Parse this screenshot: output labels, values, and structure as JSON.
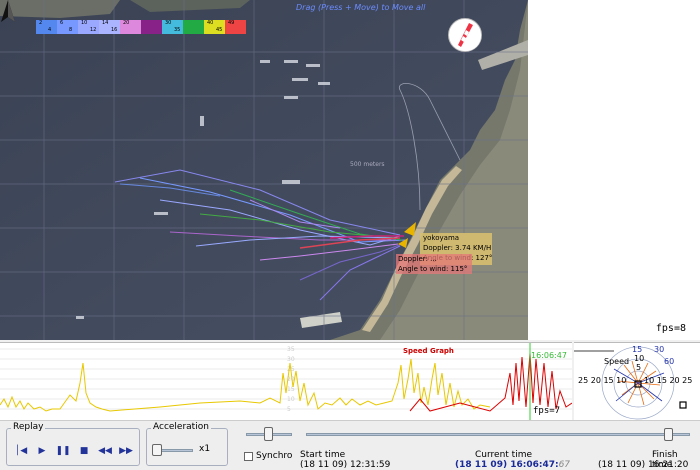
{
  "map": {
    "drag_hint": "Drag (Press + Move) to Move all",
    "meters_label": "500 meters",
    "fps_label": "fps=8",
    "legend": {
      "upper": [
        "2",
        "6",
        "10",
        "14",
        "20",
        "",
        "30",
        "",
        "40",
        "49"
      ],
      "lower": [
        "4",
        "8",
        "12",
        "16",
        "",
        "",
        "35",
        "",
        "45"
      ],
      "colors": [
        "#5588ee",
        "#7799ff",
        "#9aa8ff",
        "#aab4ff",
        "#dd88dd",
        "#882288",
        "#44bbdd",
        "#22aa44",
        "#dddd22",
        "#ee4444"
      ]
    },
    "popup": {
      "name": "yokoyama",
      "doppler": "Doppler: 3.74 KM/H",
      "angle_to_wind": "Angle to wind: 127°",
      "doppler_2": "Doppler: ...",
      "angle_to_wind_2": "Angle to wind: 115°"
    },
    "icons": {
      "north": "north-arrow-icon",
      "wind": "windsock-icon"
    }
  },
  "graph": {
    "title": "Speed Graph",
    "current_time": "16:06:47",
    "fps_label": "fps=7",
    "y_ticks": [
      "35",
      "30",
      "25",
      "20",
      "15",
      "10",
      "5"
    ]
  },
  "polar": {
    "speed_label": "Speed",
    "ring_labels": [
      "15",
      "30",
      "60",
      "10",
      "5"
    ],
    "left_labels": "25 20 15 10",
    "right_labels": "10 15 20 25"
  },
  "controls": {
    "replay_label": "Replay",
    "acceleration_label": "Acceleration",
    "acceleration_value": "x1",
    "synchro_label": "Synchro",
    "start_time_label": "Start time",
    "start_time_value": "(18 11 09) 12:31:59",
    "current_time_label": "Current time",
    "current_time_value": "(18 11 09) 16:06:47:",
    "current_time_ms": "67",
    "finish_time_label": "Finish time",
    "finish_time_value": "(18 11 09) 16:21:20",
    "buttons": [
      "rewind",
      "play",
      "pause",
      "stop",
      "step-back",
      "step-forward"
    ]
  }
}
